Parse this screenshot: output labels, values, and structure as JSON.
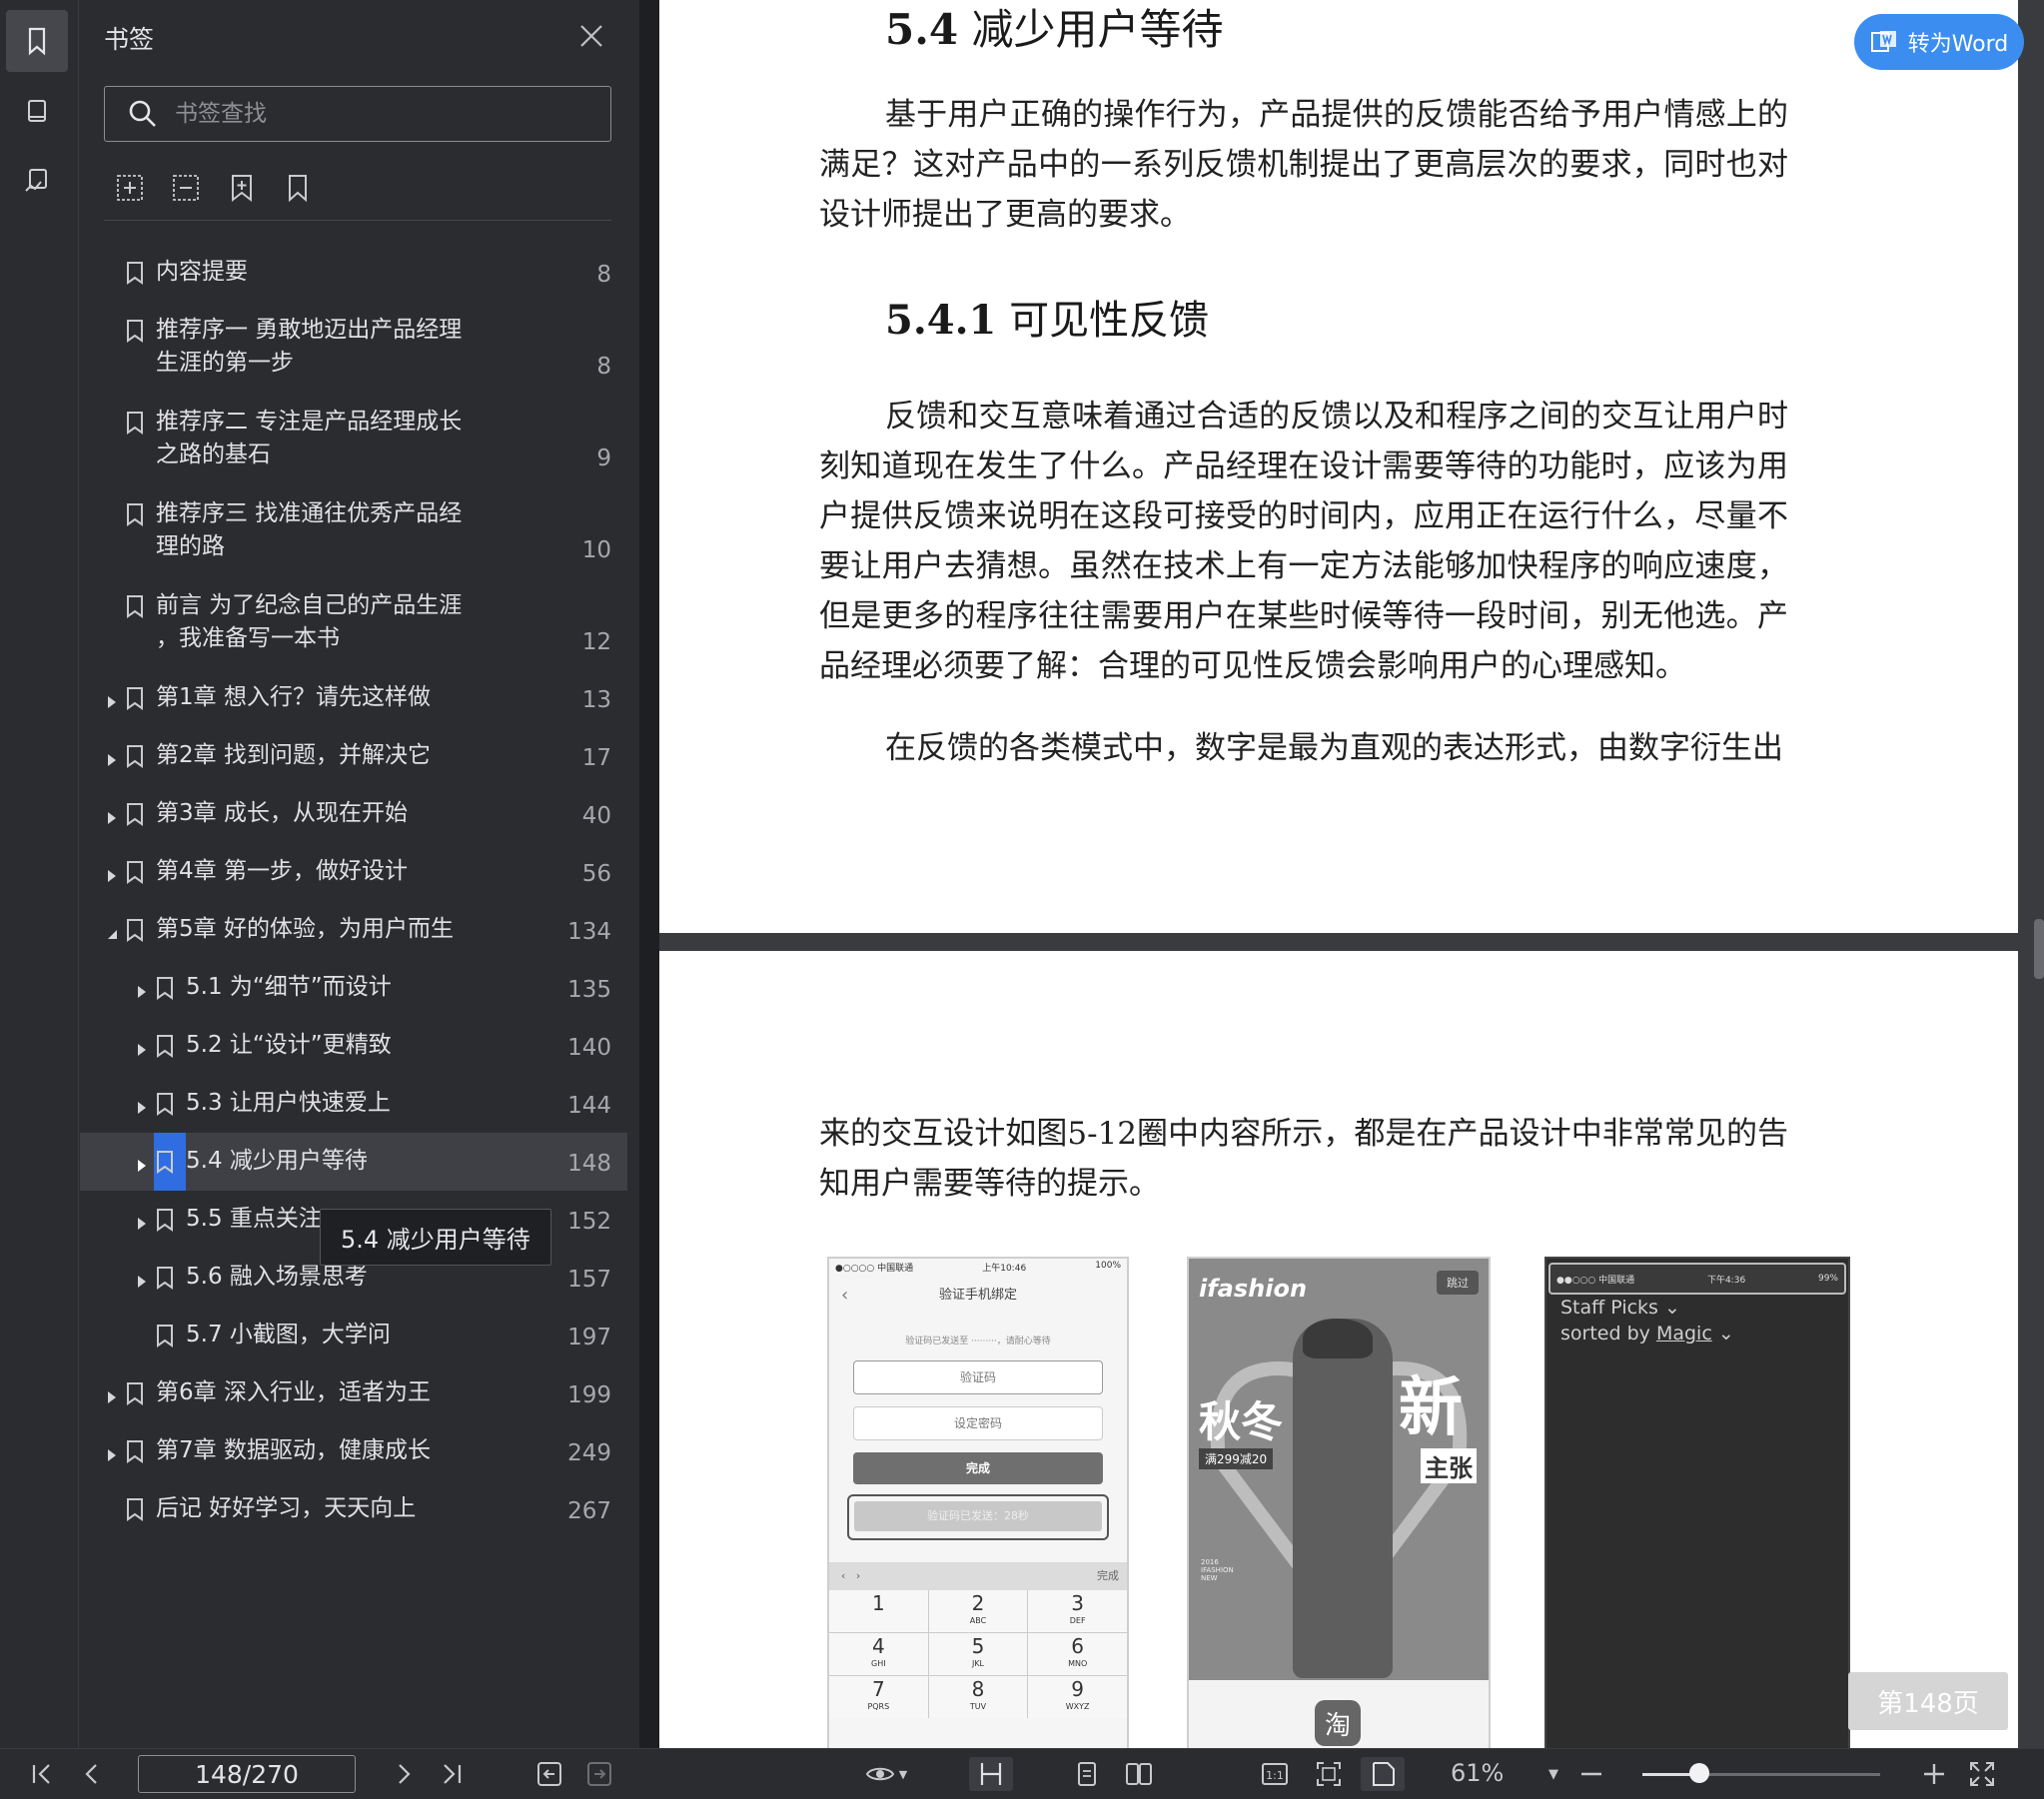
{
  "panel": {
    "title": "书签",
    "search_placeholder": "书签查找"
  },
  "tooltip": "5.4 减少用户等待",
  "bookmarks": [
    {
      "label": "内容提要",
      "page": "8",
      "level": 0,
      "expand": "none"
    },
    {
      "label": "推荐序一 勇敢地迈出产品经理\n生涯的第一步",
      "page": "8",
      "level": 0,
      "expand": "none"
    },
    {
      "label": "推荐序二 专注是产品经理成长\n之路的基石",
      "page": "9",
      "level": 0,
      "expand": "none"
    },
    {
      "label": "推荐序三 找准通往优秀产品经\n理的路",
      "page": "10",
      "level": 0,
      "expand": "none"
    },
    {
      "label": "前言 为了纪念自己的产品生涯\n，我准备写一本书",
      "page": "12",
      "level": 0,
      "expand": "none"
    },
    {
      "label": "第1章 想入行？请先这样做",
      "page": "13",
      "level": 0,
      "expand": "collapsed"
    },
    {
      "label": "第2章 找到问题，并解决它",
      "page": "17",
      "level": 0,
      "expand": "collapsed"
    },
    {
      "label": "第3章 成长，从现在开始",
      "page": "40",
      "level": 0,
      "expand": "collapsed"
    },
    {
      "label": "第4章 第一步，做好设计",
      "page": "56",
      "level": 0,
      "expand": "collapsed"
    },
    {
      "label": "第5章 好的体验，为用户而生",
      "page": "134",
      "level": 0,
      "expand": "expanded"
    },
    {
      "label": "5.1 为“细节”而设计",
      "page": "135",
      "level": 1,
      "expand": "collapsed"
    },
    {
      "label": "5.2 让“设计”更精致",
      "page": "140",
      "level": 1,
      "expand": "collapsed"
    },
    {
      "label": "5.3 让用户快速爱上",
      "page": "144",
      "level": 1,
      "expand": "collapsed"
    },
    {
      "label": "5.4 减少用户等待",
      "page": "148",
      "level": 1,
      "expand": "collapsed",
      "selected": true
    },
    {
      "label": "5.5 重点关注",
      "page": "152",
      "level": 1,
      "expand": "collapsed"
    },
    {
      "label": "5.6 融入场景思考",
      "page": "157",
      "level": 1,
      "expand": "collapsed"
    },
    {
      "label": "5.7 小截图，大学问",
      "page": "197",
      "level": 1,
      "expand": "none"
    },
    {
      "label": "第6章 深入行业，适者为王",
      "page": "199",
      "level": 0,
      "expand": "collapsed"
    },
    {
      "label": "第7章 数据驱动，健康成长",
      "page": "249",
      "level": 0,
      "expand": "collapsed"
    },
    {
      "label": "后记 好好学习，天天向上",
      "page": "267",
      "level": 0,
      "expand": "none"
    }
  ],
  "document": {
    "h_54_num": "5.4",
    "h_54_text": "减少用户等待",
    "p1": "基于用户正确的操作行为，产品提供的反馈能否给予用户情感上的满足？这对产品中的一系列反馈机制提出了更高层次的要求，同时也对设计师提出了更高的要求。",
    "h_541_num": "5.4.1",
    "h_541_text": "可见性反馈",
    "p2": "反馈和交互意味着通过合适的反馈以及和程序之间的交互让用户时刻知道现在发生了什么。产品经理在设计需要等待的功能时，应该为用户提供反馈来说明在这段可接受的时间内，应用正在运行什么，尽量不要让用户去猜想。虽然在技术上有一定方法能够加快程序的响应速度，但是更多的程序往往需要用户在某些时候等待一段时间，别无他选。产品经理必须要了解：合理的可见性反馈会影响用户的心理感知。",
    "p3": "在反馈的各类模式中，数字是最为直观的表达形式，由数字衍生出",
    "p4": "来的交互设计如图5-12圈中内容所示，都是在产品设计中非常常见的告知用户需要等待的提示。"
  },
  "phone1": {
    "status_carrier": "●○○○○ 中国联通",
    "status_time": "上午10:46",
    "status_battery": "100%",
    "title": "验证手机绑定",
    "notice": "验证码已发送至 ·········，请耐心等待",
    "code_field": "验证码",
    "password_field": "设定密码",
    "done_button": "完成",
    "countdown_button": "验证码已发送：28秒",
    "keyboard_done": "完成",
    "keys": [
      {
        "n": "1",
        "l": ""
      },
      {
        "n": "2",
        "l": "ABC"
      },
      {
        "n": "3",
        "l": "DEF"
      },
      {
        "n": "4",
        "l": "GHI"
      },
      {
        "n": "5",
        "l": "JKL"
      },
      {
        "n": "6",
        "l": "MNO"
      },
      {
        "n": "7",
        "l": "PQRS"
      },
      {
        "n": "8",
        "l": "TUV"
      },
      {
        "n": "9",
        "l": "WXYZ"
      }
    ]
  },
  "phone2": {
    "brand": "ifashion",
    "skip": "跳过",
    "big1": "秋冬",
    "big2": "新",
    "big3": "主张",
    "promo": "满299减20",
    "small": "2016 IFASHION NEW",
    "app_icon": "淘"
  },
  "phone3": {
    "status_carrier": "●●○○○ 中国联通",
    "status_time": "下午4:36",
    "status_battery": "99%",
    "line1": "Staff Picks",
    "line2_a": "sorted by",
    "line2_b": "Magic"
  },
  "word_button": "转为Word",
  "page_badge": "第148页",
  "bottom": {
    "page_input": "148/270",
    "zoom": "61%",
    "zoom_level": 0.24
  }
}
